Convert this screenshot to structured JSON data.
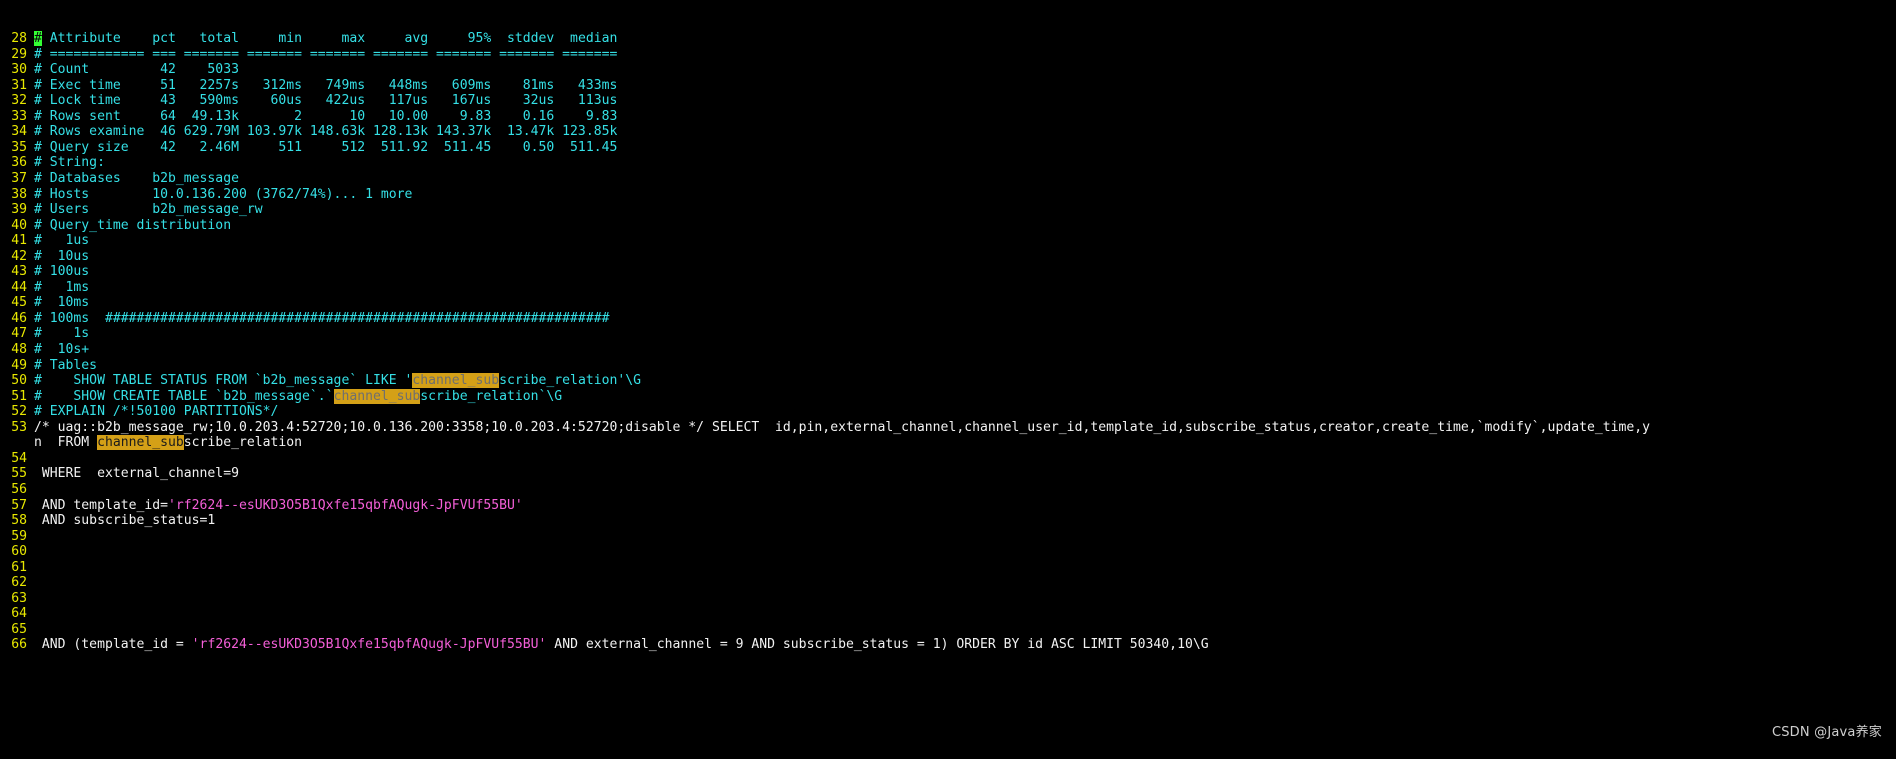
{
  "app": {
    "kind": "terminal-text-editor",
    "theme": "dark",
    "background": "#000000",
    "foreground": "#35e0e6",
    "gutter_color": "#e8e800",
    "highlight_background": "#d4a017",
    "string_color": "#f45fd8",
    "plain_text_color": "#f2f2f2",
    "cursor_color": "#33ff33"
  },
  "watermark": {
    "text": "CSDN @Java养家"
  },
  "search_term": "channel_sub",
  "lines": [
    {
      "n": "28",
      "segments": [
        {
          "t": "#",
          "c": "cursor-hash"
        },
        {
          "t": " Attribute    pct   total     min     max     avg     95%  stddev  median",
          "c": "cy"
        }
      ]
    },
    {
      "n": "29",
      "segments": [
        {
          "t": "# ============ === ======= ======= ======= ======= ======= ======= =======",
          "c": "cy"
        }
      ]
    },
    {
      "n": "30",
      "segments": [
        {
          "t": "# Count         42    5033",
          "c": "cy"
        }
      ]
    },
    {
      "n": "31",
      "segments": [
        {
          "t": "# Exec time     51   2257s   312ms   749ms   448ms   609ms    81ms   433ms",
          "c": "cy"
        }
      ]
    },
    {
      "n": "32",
      "segments": [
        {
          "t": "# Lock time     43   590ms    60us   422us   117us   167us    32us   113us",
          "c": "cy"
        }
      ]
    },
    {
      "n": "33",
      "segments": [
        {
          "t": "# Rows sent     64  49.13k       2      10   10.00    9.83    0.16    9.83",
          "c": "cy"
        }
      ]
    },
    {
      "n": "34",
      "segments": [
        {
          "t": "# Rows examine  46 629.79M 103.97k 148.63k 128.13k 143.37k  13.47k 123.85k",
          "c": "cy"
        }
      ]
    },
    {
      "n": "35",
      "segments": [
        {
          "t": "# Query size    42   2.46M     511     512  511.92  511.45    0.50  511.45",
          "c": "cy"
        }
      ]
    },
    {
      "n": "36",
      "segments": [
        {
          "t": "# String:",
          "c": "cy"
        }
      ]
    },
    {
      "n": "37",
      "segments": [
        {
          "t": "# Databases    b2b_message",
          "c": "cy"
        }
      ]
    },
    {
      "n": "38",
      "segments": [
        {
          "t": "# Hosts        10.0.136.200 (3762/74%)... 1 more",
          "c": "cy"
        }
      ]
    },
    {
      "n": "39",
      "segments": [
        {
          "t": "# Users        b2b_message_rw",
          "c": "cy"
        }
      ]
    },
    {
      "n": "40",
      "segments": [
        {
          "t": "# Query_time distribution",
          "c": "cy"
        }
      ]
    },
    {
      "n": "41",
      "segments": [
        {
          "t": "#   1us",
          "c": "cy"
        }
      ]
    },
    {
      "n": "42",
      "segments": [
        {
          "t": "#  10us",
          "c": "cy"
        }
      ]
    },
    {
      "n": "43",
      "segments": [
        {
          "t": "# 100us",
          "c": "cy"
        }
      ]
    },
    {
      "n": "44",
      "segments": [
        {
          "t": "#   1ms",
          "c": "cy"
        }
      ]
    },
    {
      "n": "45",
      "segments": [
        {
          "t": "#  10ms",
          "c": "cy"
        }
      ]
    },
    {
      "n": "46",
      "segments": [
        {
          "t": "# 100ms  ################################################################",
          "c": "cy"
        }
      ]
    },
    {
      "n": "47",
      "segments": [
        {
          "t": "#    1s",
          "c": "cy"
        }
      ]
    },
    {
      "n": "48",
      "segments": [
        {
          "t": "#  10s+",
          "c": "cy"
        }
      ]
    },
    {
      "n": "49",
      "segments": [
        {
          "t": "# Tables",
          "c": "cy"
        }
      ]
    },
    {
      "n": "50",
      "segments": [
        {
          "t": "#    SHOW TABLE STATUS FROM `b2b_message` LIKE '",
          "c": "cy"
        },
        {
          "t": "channel_sub",
          "c": "hlsel"
        },
        {
          "t": "scribe_relation'\\G",
          "c": "cy"
        }
      ]
    },
    {
      "n": "51",
      "segments": [
        {
          "t": "#    SHOW CREATE TABLE `b2b_message`.`",
          "c": "cy"
        },
        {
          "t": "channel_sub",
          "c": "hlsel"
        },
        {
          "t": "scribe_relation`\\G",
          "c": "cy"
        }
      ]
    },
    {
      "n": "52",
      "segments": [
        {
          "t": "# EXPLAIN /*!50100 PARTITIONS*/",
          "c": "cy"
        }
      ]
    },
    {
      "n": "53",
      "segments": [
        {
          "t": "/* uag::b2b_message_rw;10.0.203.4:52720;10.0.136.200:3358;10.0.203.4:52720;disable */ SELECT  id,pin,external_channel,channel_user_id,template_id,subscribe_status,creator,create_time,`modify`,update_time,y",
          "c": "wh"
        }
      ]
    },
    {
      "n": "",
      "cont": true,
      "segments": [
        {
          "t": "n  FROM ",
          "c": "wh"
        },
        {
          "t": "channel_sub",
          "c": "hl"
        },
        {
          "t": "scribe_relation",
          "c": "wh"
        }
      ]
    },
    {
      "n": "54",
      "segments": []
    },
    {
      "n": "55",
      "segments": [
        {
          "t": " WHERE  external_channel=9",
          "c": "wh"
        }
      ]
    },
    {
      "n": "56",
      "segments": []
    },
    {
      "n": "57",
      "segments": [
        {
          "t": " AND template_id=",
          "c": "wh"
        },
        {
          "t": "'rf2624--esUKD3O5B1Qxfe15qbfAQugk-JpFVUf55BU'",
          "c": "mg"
        }
      ]
    },
    {
      "n": "58",
      "segments": [
        {
          "t": " AND subscribe_status=1",
          "c": "wh"
        }
      ]
    },
    {
      "n": "59",
      "segments": []
    },
    {
      "n": "60",
      "segments": []
    },
    {
      "n": "61",
      "segments": []
    },
    {
      "n": "62",
      "segments": []
    },
    {
      "n": "63",
      "segments": []
    },
    {
      "n": "64",
      "segments": []
    },
    {
      "n": "65",
      "segments": []
    },
    {
      "n": "66",
      "segments": [
        {
          "t": " AND (template_id = ",
          "c": "wh"
        },
        {
          "t": "'rf2624--esUKD3O5B1Qxfe15qbfAQugk-JpFVUf55BU'",
          "c": "mg"
        },
        {
          "t": " AND external_channel = 9 AND subscribe_status = 1) ORDER BY id ASC LIMIT 50340,10\\G",
          "c": "wh"
        }
      ]
    }
  ]
}
